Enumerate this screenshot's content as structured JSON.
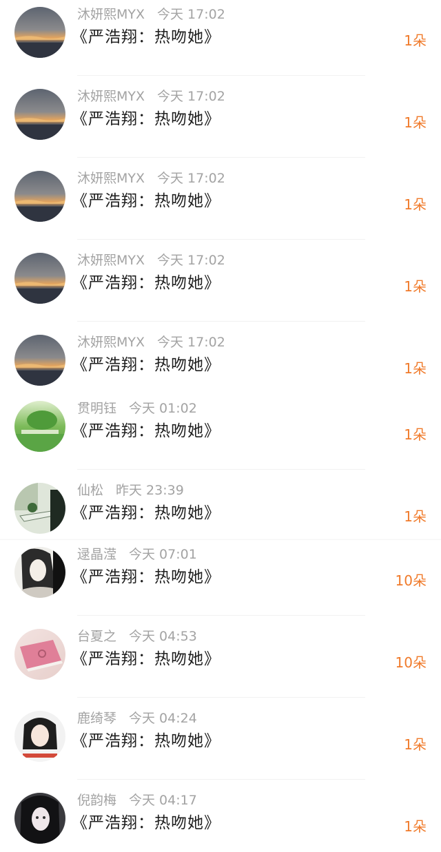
{
  "items": [
    {
      "name": "沐妍熙MYX",
      "time": "今天 17:02",
      "content": "《严浩翔：热吻她》",
      "gift": "1朵",
      "avatar_icon": "sunset-avatar-icon"
    },
    {
      "name": "沐妍熙MYX",
      "time": "今天 17:02",
      "content": "《严浩翔：热吻她》",
      "gift": "1朵",
      "avatar_icon": "sunset-avatar-icon"
    },
    {
      "name": "沐妍熙MYX",
      "time": "今天 17:02",
      "content": "《严浩翔：热吻她》",
      "gift": "1朵",
      "avatar_icon": "sunset-avatar-icon"
    },
    {
      "name": "沐妍熙MYX",
      "time": "今天 17:02",
      "content": "《严浩翔：热吻她》",
      "gift": "1朵",
      "avatar_icon": "sunset-avatar-icon"
    },
    {
      "name": "沐妍熙MYX",
      "time": "今天 17:02",
      "content": "《严浩翔：热吻她》",
      "gift": "1朵",
      "avatar_icon": "sunset-avatar-icon"
    },
    {
      "name": "贯明钰",
      "time": "今天 01:02",
      "content": "《严浩翔：热吻她》",
      "gift": "1朵",
      "avatar_icon": "green-park-avatar-icon"
    },
    {
      "name": "仙松",
      "time": "昨天 23:39",
      "content": "《严浩翔：热吻她》",
      "gift": "1朵",
      "avatar_icon": "garden-table-avatar-icon"
    },
    {
      "name": "逯晶滢",
      "time": "今天 07:01",
      "content": "《严浩翔：热吻她》",
      "gift": "10朵",
      "avatar_icon": "drawn-portrait-avatar-icon"
    },
    {
      "name": "台夏之",
      "time": "今天 04:53",
      "content": "《严浩翔：热吻她》",
      "gift": "10朵",
      "avatar_icon": "pink-book-avatar-icon"
    },
    {
      "name": "鹿绮琴",
      "time": "今天 04:24",
      "content": "《严浩翔：热吻她》",
      "gift": "1朵",
      "avatar_icon": "girl-portrait-avatar-icon"
    },
    {
      "name": "倪韵梅",
      "time": "今天 04:17",
      "content": "《严浩翔：热吻她》",
      "gift": "1朵",
      "avatar_icon": "girl-dark-avatar-icon"
    }
  ],
  "colors": {
    "name": "#a3a3a3",
    "content": "#1f1f1f",
    "gift": "#f07a2a",
    "background": "#ffffff"
  }
}
